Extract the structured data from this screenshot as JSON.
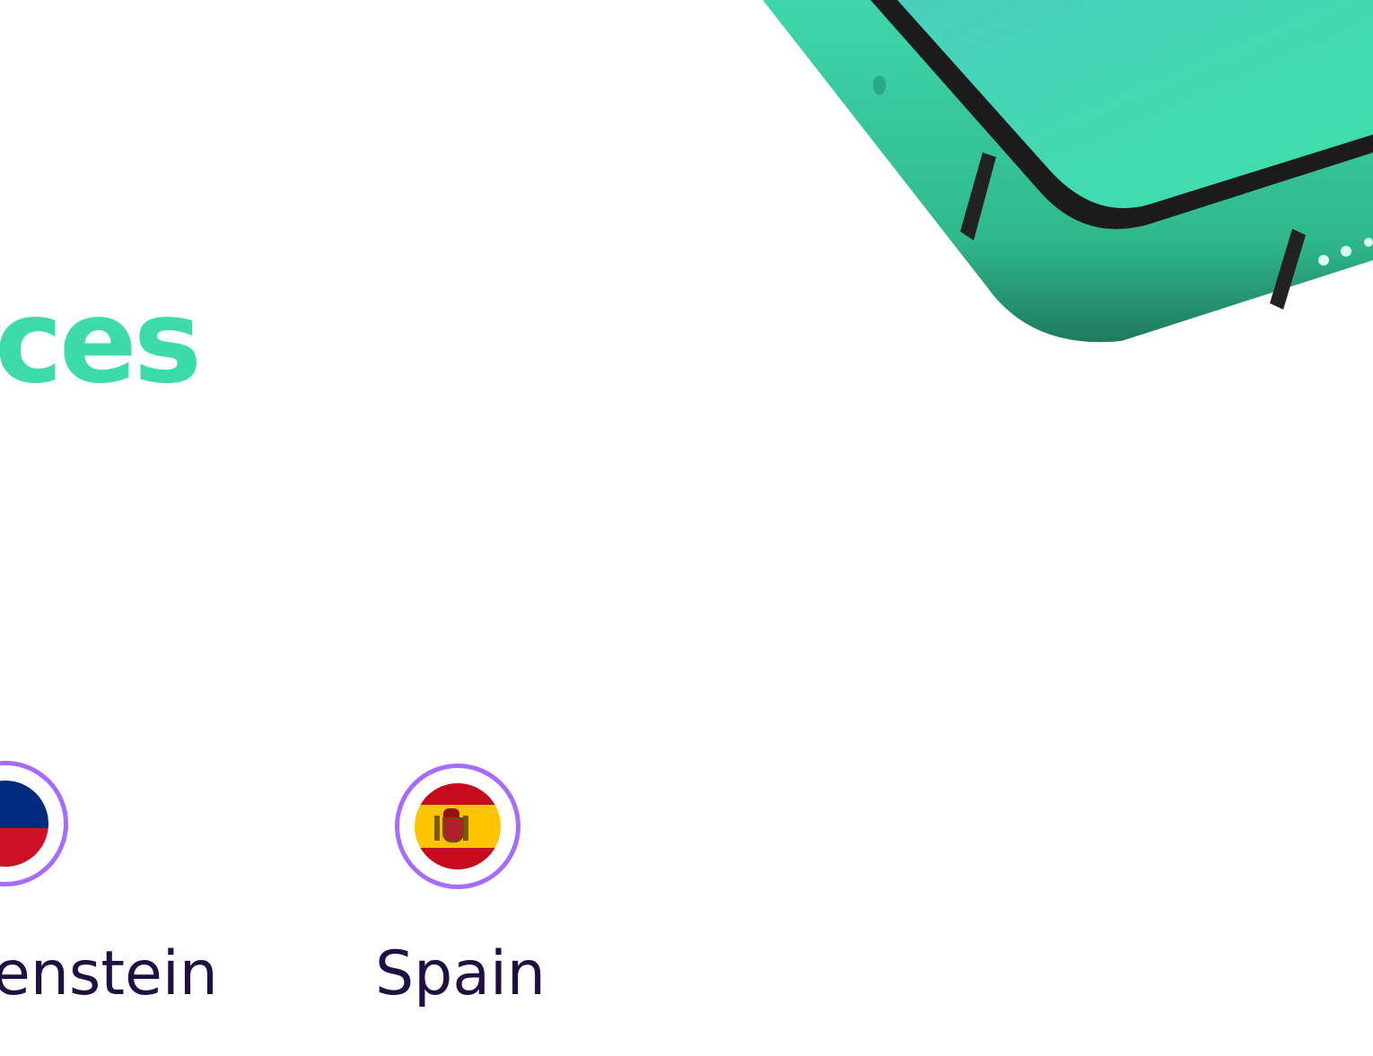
{
  "hero": {
    "heading": "ces",
    "heading_color": "#3cdba9"
  },
  "countries": [
    {
      "name": "enstein",
      "flag_icon": "liechtenstein-flag-icon",
      "ring_color": "#a66bff"
    },
    {
      "name": "Spain",
      "flag_icon": "spain-flag-icon",
      "ring_color": "#a66bff"
    }
  ],
  "colors": {
    "text_dark": "#1f0f42",
    "phone_body": "#3ddba8",
    "phone_bezel": "#1b1b1b"
  }
}
